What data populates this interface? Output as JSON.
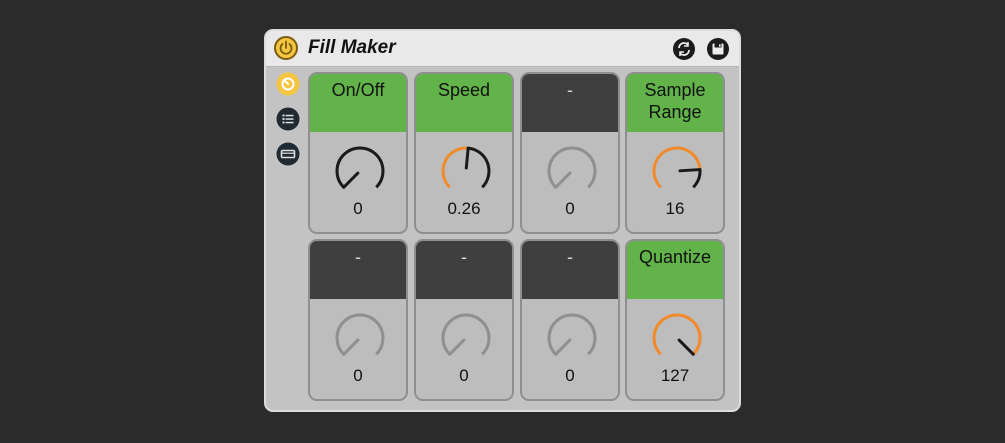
{
  "device": {
    "title": "Fill Maker",
    "power_icon": "power-icon",
    "sync_icon": "sync-icon",
    "save_icon": "save-icon"
  },
  "sidebar": [
    {
      "icon": "device-view-icon",
      "active": true
    },
    {
      "icon": "list-icon",
      "active": false
    },
    {
      "icon": "fold-icon",
      "active": false
    }
  ],
  "colors": {
    "active_header": "#62b34a",
    "inactive_header": "#3f3f3f",
    "arc_active": "#f08a2b",
    "arc_inactive": "#8f8f8f",
    "power": "#f5c542"
  },
  "knobs": [
    {
      "label": "On/Off",
      "value": "0",
      "level": 0.0,
      "active": true,
      "arc_colored": false
    },
    {
      "label": "Speed",
      "value": "0.26",
      "level": 0.52,
      "active": true,
      "arc_colored": true
    },
    {
      "label": "-",
      "value": "0",
      "level": 0.0,
      "active": false,
      "arc_colored": false
    },
    {
      "label": "Sample Range",
      "value": "16",
      "level": 0.82,
      "active": true,
      "arc_colored": true
    },
    {
      "label": "-",
      "value": "0",
      "level": 0.0,
      "active": false,
      "arc_colored": false
    },
    {
      "label": "-",
      "value": "0",
      "level": 0.0,
      "active": false,
      "arc_colored": false
    },
    {
      "label": "-",
      "value": "0",
      "level": 0.0,
      "active": false,
      "arc_colored": false
    },
    {
      "label": "Quantize",
      "value": "127",
      "level": 1.0,
      "active": true,
      "arc_colored": true
    }
  ]
}
